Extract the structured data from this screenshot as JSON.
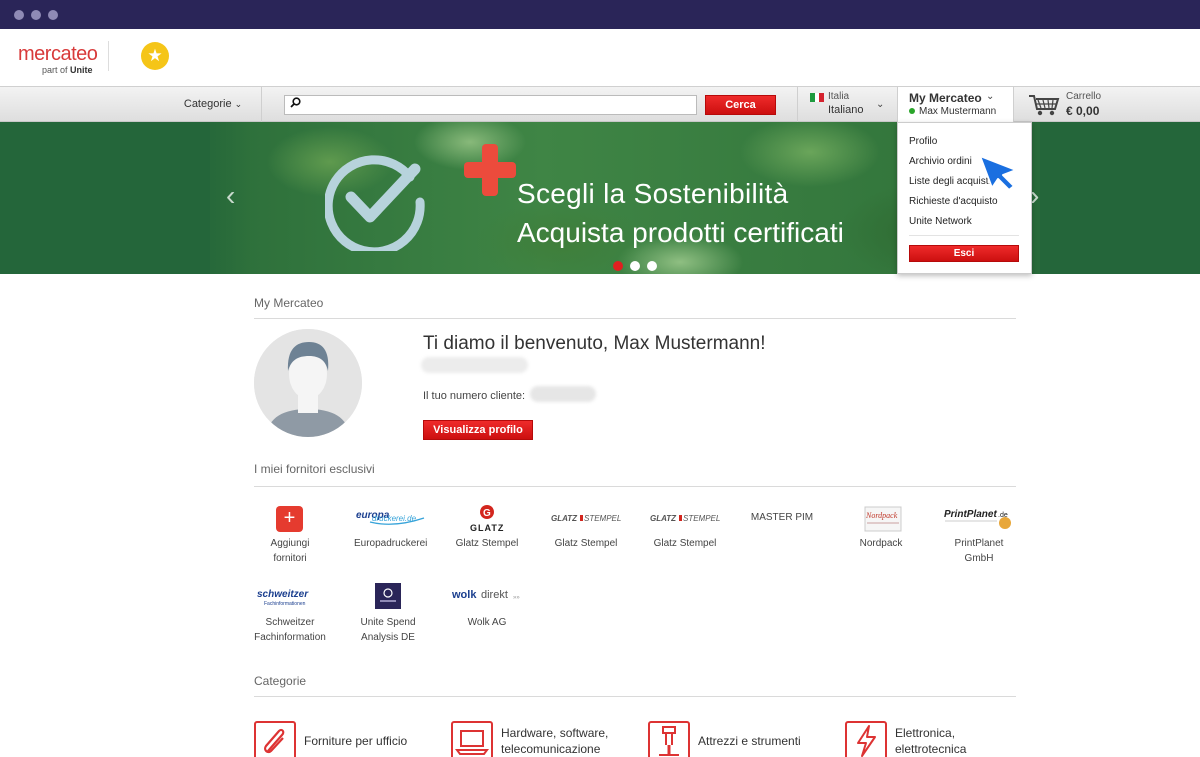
{
  "header": {
    "logo_word": "mercateo",
    "logo_sub_prefix": "part of",
    "logo_sub_brand": "Unite"
  },
  "nav": {
    "categories_label": "Categorie",
    "search_placeholder": "",
    "search_button": "Cerca",
    "country": "Italia",
    "language": "Italiano",
    "my_mercateo": "My Mercateo",
    "user_name": "Max Mustermann",
    "cart_label": "Carrello",
    "cart_amount": "€ 0,00"
  },
  "banner": {
    "headline": "Scegli la Sostenibilità",
    "subline": "Acquista prodotti certificati",
    "slides": 3,
    "active_slide": 1
  },
  "dropdown": {
    "items": [
      "Profilo",
      "Archivio ordini",
      "Liste degli acquisti",
      "Richieste d'acquisto",
      "Unite Network"
    ],
    "logout": "Esci"
  },
  "my_mercateo": {
    "section_title": "My Mercateo",
    "welcome": "Ti diamo il benvenuto, Max Mustermann!",
    "customer_number_label": "Il tuo numero cliente:",
    "profile_button": "Visualizza profilo"
  },
  "suppliers": {
    "section_title": "I miei fornitori esclusivi",
    "items": [
      {
        "name": "Aggiungi fornitori",
        "logo": "add-icon"
      },
      {
        "name": "Europadruckerei",
        "logo": "europadruckerei.de"
      },
      {
        "name": "Glatz Stempel",
        "logo": "GLATZ"
      },
      {
        "name": "Glatz Stempel",
        "logo": "GLATZ STEMPEL"
      },
      {
        "name": "Glatz Stempel",
        "logo": "GLATZ STEMPEL"
      },
      {
        "name": "",
        "logo": "MASTER PIM"
      },
      {
        "name": "Nordpack",
        "logo": "Nordpack"
      },
      {
        "name": "PrintPlanet GmbH",
        "logo": "PrintPlanet.de"
      },
      {
        "name": "Schweitzer Fachinformation",
        "logo": "schweitzer"
      },
      {
        "name": "Unite Spend Analysis DE",
        "logo": "unite-badge"
      },
      {
        "name": "Wolk AG",
        "logo": "wolkdirekt"
      }
    ]
  },
  "categories": {
    "section_title": "Categorie",
    "items": [
      {
        "name": "Forniture per ufficio",
        "icon": "paperclip-icon"
      },
      {
        "name": "Hardware, software, telecomunicazione",
        "icon": "laptop-icon"
      },
      {
        "name": "Attrezzi e strumenti",
        "icon": "drill-icon"
      },
      {
        "name": "Elettronica, elettrotecnica",
        "icon": "lightning-icon"
      }
    ]
  },
  "colors": {
    "accent_red": "#e02020",
    "chrome": "#2a2558",
    "banner_green": "#24663a"
  }
}
